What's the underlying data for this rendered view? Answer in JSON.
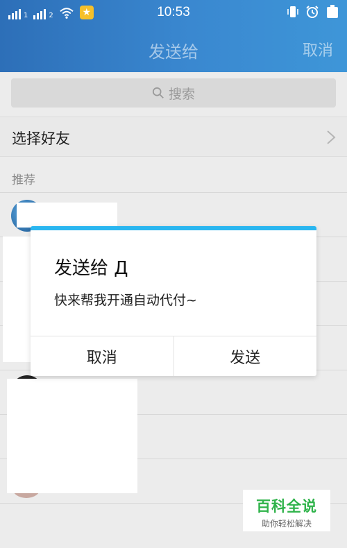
{
  "status_bar": {
    "sim1": "1",
    "sim2": "2",
    "time": "10:53"
  },
  "nav": {
    "title": "发送给",
    "cancel_label": "取消"
  },
  "search": {
    "placeholder": "搜索"
  },
  "select_friends": {
    "label": "选择好友"
  },
  "section": {
    "label": "推荐"
  },
  "dialog": {
    "title": "发送给 Д",
    "message": "快来帮我开通自动代付~",
    "cancel_label": "取消",
    "send_label": "发送",
    "accent_color": "#29b6f0"
  },
  "watermark": {
    "main": "百科全说",
    "sub": "助你轻松解决"
  },
  "colors": {
    "header_start": "#2d6fb8",
    "header_end": "#3e96d8",
    "badge": "#f6c02a"
  }
}
